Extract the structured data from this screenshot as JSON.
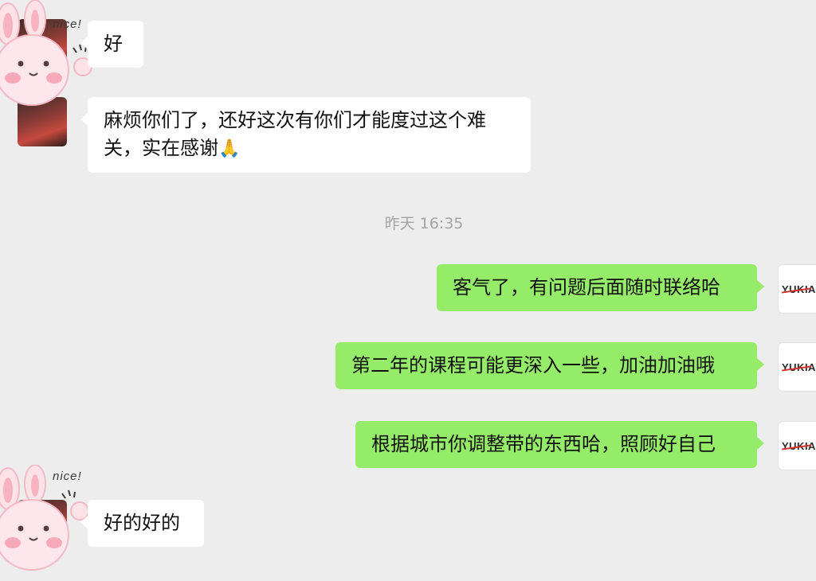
{
  "conversation": {
    "messages_top": [
      {
        "sender": "contact",
        "text": "好"
      },
      {
        "sender": "contact",
        "text": "麻烦你们了，还好这次有你们才能度过这个难关，实在感谢",
        "emoji": "🙏"
      }
    ],
    "timestamp": "昨天 16:35",
    "messages_out": [
      {
        "sender": "me",
        "text": "客气了，有问题后面随时联络哈"
      },
      {
        "sender": "me",
        "text": "第二年的课程可能更深入一些，加油加油哦"
      },
      {
        "sender": "me",
        "text": "根据城市你调整带的东西哈，照顾好自己"
      }
    ],
    "messages_bottom": [
      {
        "sender": "contact",
        "text": "好的好的"
      }
    ]
  },
  "sticker": {
    "caption": "nice!"
  },
  "self_avatar": {
    "logo_text": "YUKIA"
  },
  "colors": {
    "background": "#ededed",
    "incoming_bubble": "#ffffff",
    "outgoing_bubble": "#95ec69",
    "timestamp_text": "#a3a3a3"
  }
}
